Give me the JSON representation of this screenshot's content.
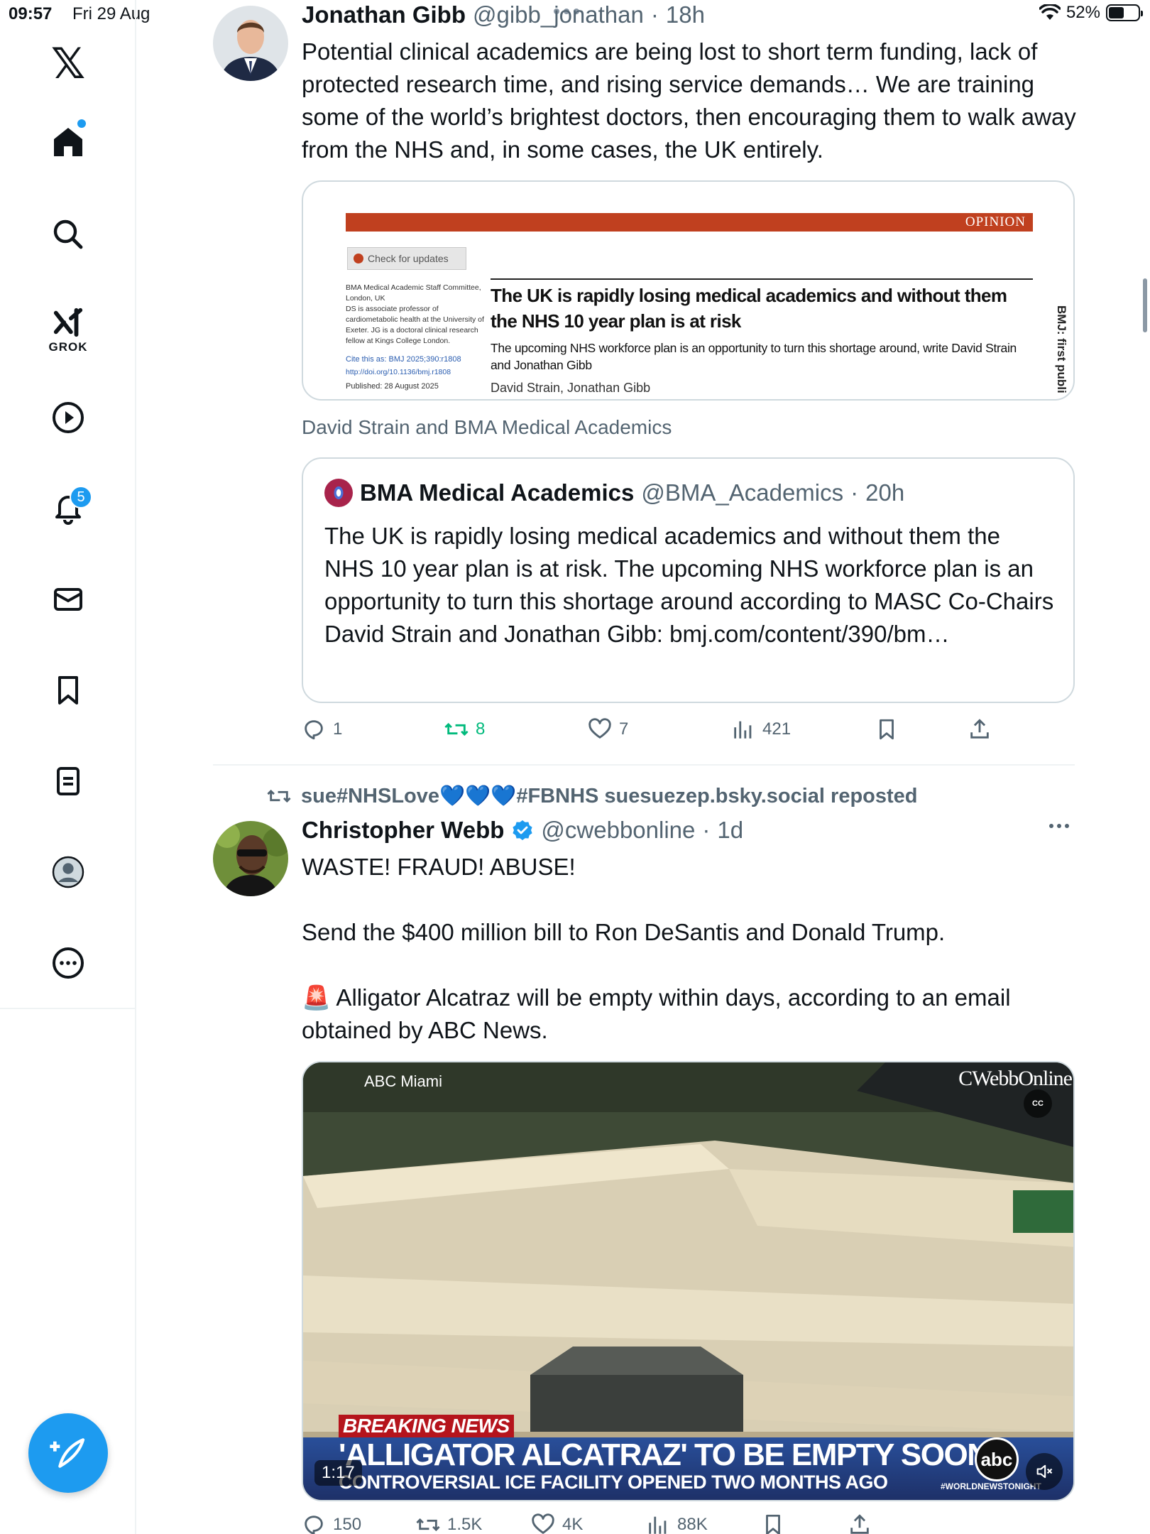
{
  "status_bar": {
    "time": "09:57",
    "date": "Fri 29 Aug",
    "battery": "52%",
    "battery_level": 0.52
  },
  "sidebar": {
    "grok_label": "GROK",
    "notifications_count": "5",
    "items": [
      "x-logo",
      "home-icon",
      "search-icon",
      "grok-icon",
      "video-icon",
      "bell-icon",
      "mail-icon",
      "bookmark-icon",
      "lists-icon",
      "profile-icon",
      "more-icon"
    ]
  },
  "post1": {
    "name": "Jonathan Gibb",
    "handle": "@gibb_jonathan",
    "time": "18h",
    "text": "Potential clinical academics are being lost to short term funding, lack of protected research time, and rising service demands… We are training some of the world’s brightest doctors, then encouraging them to walk away from the NHS and, in some cases, the UK entirely.",
    "article": {
      "banner": "OPINION",
      "check_updates": "Check for updates",
      "affil": "BMA Medical Academic Staff Committee, London, UK\nDS is associate professor of cardiometabolic health at the University of Exeter. JG is a doctoral clinical research fellow at Kings College London.",
      "cite": "Cite this as: BMJ 2025;390:r1808",
      "doi": "http://doi.org/10.1136/bmj.r1808",
      "published": "Published: 28 August 2025",
      "headline": "The UK is rapidly losing medical academics and without them the NHS 10 year plan is at risk",
      "standfirst": "The upcoming NHS workforce plan is an opportunity to turn this shortage around, write David Strain and Jonathan Gibb",
      "authors": "David Strain, Jonathan Gibb",
      "side_text": "BMJ: first publi"
    },
    "card_caption": "David Strain and BMA Medical Academics",
    "quote": {
      "name": "BMA Medical Academics",
      "handle": "@BMA_Academics",
      "time": "20h",
      "text": "The UK is rapidly losing medical academics and without them the NHS 10 year plan is at risk. The upcoming NHS workforce plan is an opportunity to turn this shortage around according to MASC Co-Chairs David Strain and Jonathan Gibb: bmj.com/content/390/bm…"
    },
    "actions": {
      "replies": "1",
      "reposts": "8",
      "likes": "7",
      "views": "421"
    }
  },
  "post2": {
    "repost_label": "sue#NHSLove💙💙💙#FBNHS suesuezep.bsky.social reposted",
    "name": "Christopher Webb",
    "handle": "@cwebbonline",
    "time": "1d",
    "text": "WASTE! FRAUD! ABUSE!\n\nSend the $400 million bill to Ron DeSantis and Donald Trump.\n\n🚨 Alligator Alcatraz will be empty within days, according to an email obtained by ABC News.",
    "video": {
      "station": "ABC Miami",
      "watermark": "CWebbOnline",
      "breaking": "BREAKING NEWS",
      "headline": "'ALLIGATOR ALCATRAZ' TO BE EMPTY SOON",
      "subline": "CONTROVERSIAL ICE FACILITY OPENED TWO MONTHS AGO",
      "hashtag": "#WORLDNEWSTONIGHT",
      "logo": "abc",
      "cc": "CC",
      "duration": "1:17"
    },
    "actions": {
      "replies": "150",
      "reposts": "1.5K",
      "likes": "4K",
      "views": "88K"
    }
  }
}
